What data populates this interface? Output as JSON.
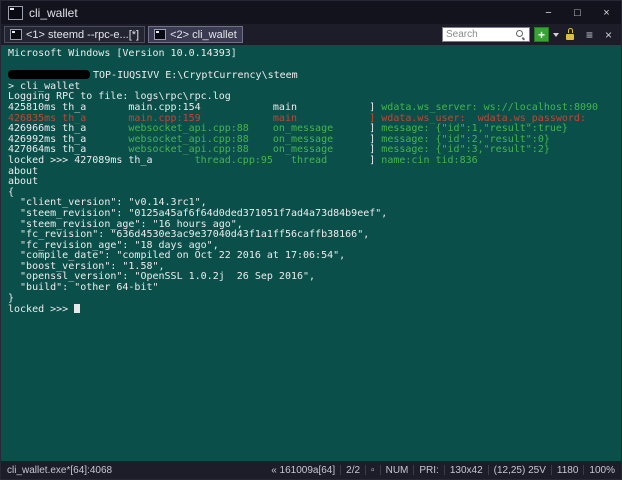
{
  "titlebar": {
    "title": "cli_wallet",
    "buttons": [
      {
        "name": "minimize",
        "glyph": "−"
      },
      {
        "name": "maximize",
        "glyph": "□"
      },
      {
        "name": "close",
        "glyph": "×"
      }
    ]
  },
  "tabs": [
    {
      "id": "1-steemd",
      "label": "<1> steemd  --rpc-e...[*]",
      "active": false
    },
    {
      "id": "2-cli-wallet",
      "label": "<2> cli_wallet",
      "active": true
    }
  ],
  "toolbar": {
    "search_placeholder": "Search",
    "new_console_label": "+",
    "menu_glyph": "≡",
    "close_glyph": "×"
  },
  "console": {
    "lines": [
      {
        "segments": [
          {
            "text": "Microsoft Windows [Version 10.0.14393]",
            "color": "fg"
          }
        ]
      },
      {
        "segments": [
          {
            "text": "",
            "color": "fg"
          }
        ]
      },
      {
        "segments": [
          {
            "redact": true
          },
          {
            "text": "TOP-IUQSIVV E:\\CryptCurrency\\steem",
            "color": "fg"
          }
        ]
      },
      {
        "segments": [
          {
            "text": "> cli_wallet",
            "color": "fg"
          }
        ]
      },
      {
        "segments": [
          {
            "text": "Logging RPC to file: logs\\rpc\\rpc.log",
            "color": "fg"
          }
        ]
      },
      {
        "segments": [
          {
            "text": "425810ms th_a       main.cpp:154            main            ",
            "color": "fg"
          },
          {
            "text": "] ",
            "color": "fg"
          },
          {
            "text": "wdata.ws_server: ws://localhost:8090",
            "color": "green"
          }
        ]
      },
      {
        "segments": [
          {
            "text": "426835ms th_a       main.cpp:159            main            ] wdata.ws_user:  wdata.ws_password:",
            "color": "red"
          }
        ]
      },
      {
        "segments": [
          {
            "text": "426966ms th_a       ",
            "color": "fg"
          },
          {
            "text": "websocket_api.cpp:88    on_message      ",
            "color": "green"
          },
          {
            "text": "] ",
            "color": "fg"
          },
          {
            "text": "message: {\"id\":1,\"result\":true}",
            "color": "green"
          }
        ]
      },
      {
        "segments": [
          {
            "text": "426992ms th_a       ",
            "color": "fg"
          },
          {
            "text": "websocket_api.cpp:88    on_message      ",
            "color": "green"
          },
          {
            "text": "] ",
            "color": "fg"
          },
          {
            "text": "message: {\"id\":2,\"result\":0}",
            "color": "green"
          }
        ]
      },
      {
        "segments": [
          {
            "text": "427064ms th_a       ",
            "color": "fg"
          },
          {
            "text": "websocket_api.cpp:88    on_message      ",
            "color": "green"
          },
          {
            "text": "] ",
            "color": "fg"
          },
          {
            "text": "message: {\"id\":3,\"result\":2}",
            "color": "green"
          }
        ]
      },
      {
        "segments": [
          {
            "text": "locked >>> 427089ms th_a       ",
            "color": "fg"
          },
          {
            "text": "thread.cpp:95   thread       ",
            "color": "green"
          },
          {
            "text": "] ",
            "color": "fg"
          },
          {
            "text": "name:cin tid:836",
            "color": "green"
          }
        ]
      },
      {
        "segments": [
          {
            "text": "about",
            "color": "fg"
          }
        ]
      },
      {
        "segments": [
          {
            "text": "about",
            "color": "fg"
          }
        ]
      },
      {
        "segments": [
          {
            "text": "{",
            "color": "fg"
          }
        ]
      },
      {
        "segments": [
          {
            "text": "  \"client_version\": \"v0.14.3rc1\",",
            "color": "fg"
          }
        ]
      },
      {
        "segments": [
          {
            "text": "  \"steem_revision\": \"0125a45af6f64d0ded371051f7ad4a73d84b9eef\",",
            "color": "fg"
          }
        ]
      },
      {
        "segments": [
          {
            "text": "  \"steem_revision_age\": \"16 hours ago\",",
            "color": "fg"
          }
        ]
      },
      {
        "segments": [
          {
            "text": "  \"fc_revision\": \"636d4530e3ac9e37040d43f1a1ff56caffb38166\",",
            "color": "fg"
          }
        ]
      },
      {
        "segments": [
          {
            "text": "  \"fc_revision_age\": \"18 days ago\",",
            "color": "fg"
          }
        ]
      },
      {
        "segments": [
          {
            "text": "  \"compile_date\": \"compiled on Oct 22 2016 at 17:06:54\",",
            "color": "fg"
          }
        ]
      },
      {
        "segments": [
          {
            "text": "  \"boost_version\": \"1.58\",",
            "color": "fg"
          }
        ]
      },
      {
        "segments": [
          {
            "text": "  \"openssl_version\": \"OpenSSL 1.0.2j  26 Sep 2016\",",
            "color": "fg"
          }
        ]
      },
      {
        "segments": [
          {
            "text": "  \"build\": \"other 64-bit\"",
            "color": "fg"
          }
        ]
      },
      {
        "segments": [
          {
            "text": "}",
            "color": "fg"
          }
        ]
      },
      {
        "segments": [
          {
            "text": "locked >>> ",
            "color": "fg"
          },
          {
            "cursor": true
          }
        ]
      }
    ]
  },
  "statusbar": {
    "process": "cli_wallet.exe*[64]:4068",
    "items": [
      {
        "name": "version",
        "text": "« 161009a[64]"
      },
      {
        "name": "tab-index",
        "text": "2/2"
      },
      {
        "name": "console-flag",
        "text": "▫"
      },
      {
        "name": "num-lock",
        "text": "NUM"
      },
      {
        "name": "priority",
        "text": "PRI:"
      },
      {
        "name": "console-size",
        "text": "130x42"
      },
      {
        "name": "cursor-pos",
        "text": "(12,25) 25V"
      },
      {
        "name": "buffer-height",
        "text": "1180"
      },
      {
        "name": "zoom",
        "text": "100%"
      }
    ]
  },
  "colors": {
    "console_bg": "#0B4F4B",
    "fg": "#ECECEC",
    "green": "#44B54C",
    "red": "#C4452E"
  }
}
